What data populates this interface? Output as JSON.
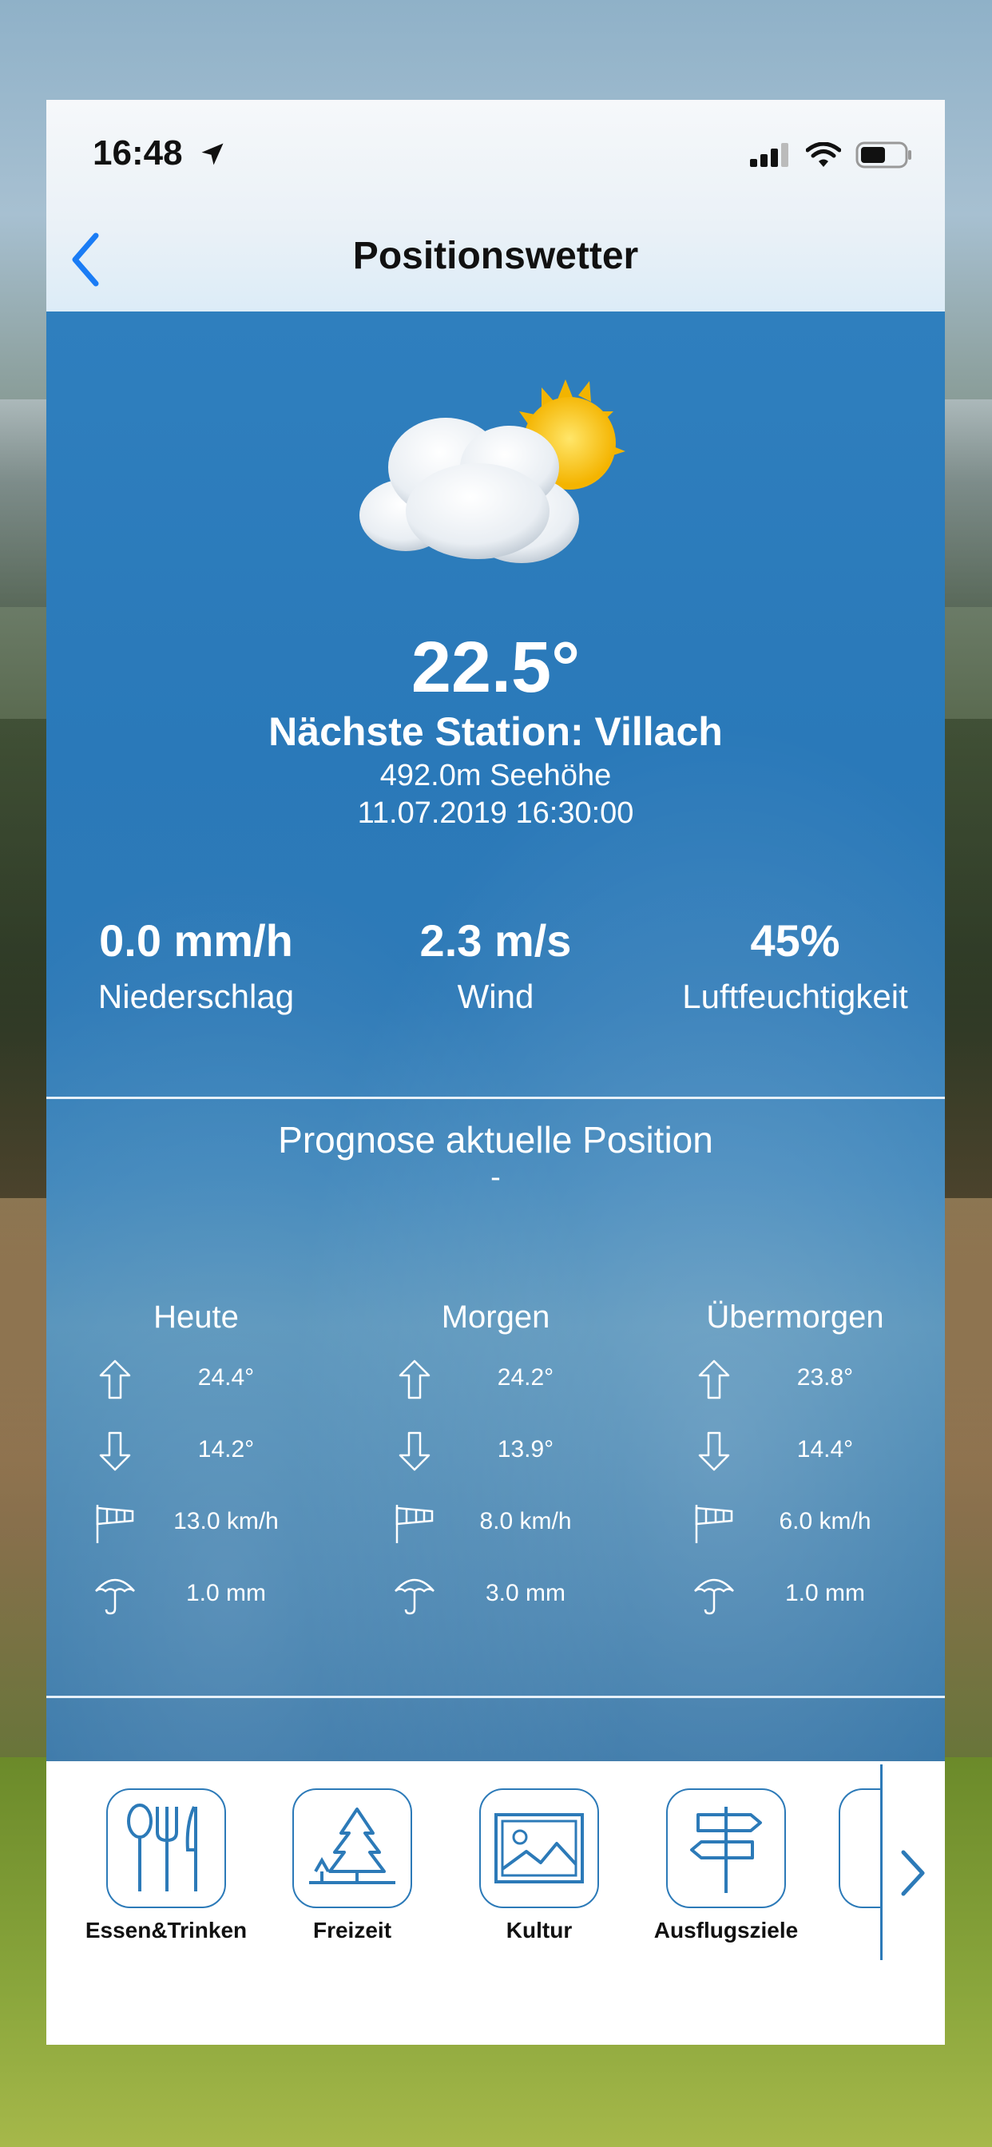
{
  "status_bar": {
    "time": "16:48"
  },
  "header": {
    "title": "Positionswetter"
  },
  "current": {
    "temperature": "22.5°",
    "station": "Nächste Station: Villach",
    "altitude": "492.0m Seehöhe",
    "timestamp": "11.07.2019 16:30:00"
  },
  "stats": [
    {
      "value": "0.0 mm/h",
      "label": "Niederschlag"
    },
    {
      "value": "2.3 m/s",
      "label": "Wind"
    },
    {
      "value": "45%",
      "label": "Luftfeuchtigkeit"
    }
  ],
  "forecast": {
    "title": "Prognose aktuelle Position",
    "subtitle": "-",
    "days": [
      {
        "name": "Heute",
        "max": "24.4°",
        "min": "14.2°",
        "wind": "13.0 km/h",
        "rain": "1.0 mm"
      },
      {
        "name": "Morgen",
        "max": "24.2°",
        "min": "13.9°",
        "wind": "8.0 km/h",
        "rain": "3.0 mm"
      },
      {
        "name": "Übermorgen",
        "max": "23.8°",
        "min": "14.4°",
        "wind": "6.0 km/h",
        "rain": "1.0 mm"
      }
    ]
  },
  "categories": [
    {
      "label": "Essen&Trinken",
      "icon": "fork-spoon-knife-icon"
    },
    {
      "label": "Freizeit",
      "icon": "pine-tree-icon"
    },
    {
      "label": "Kultur",
      "icon": "picture-icon"
    },
    {
      "label": "Ausflugsziele",
      "icon": "signpost-icon"
    }
  ],
  "colors": {
    "accent": "#2c7ab8",
    "ios_blue": "#1a7cf5",
    "hero_blue": "#2a79b9"
  }
}
